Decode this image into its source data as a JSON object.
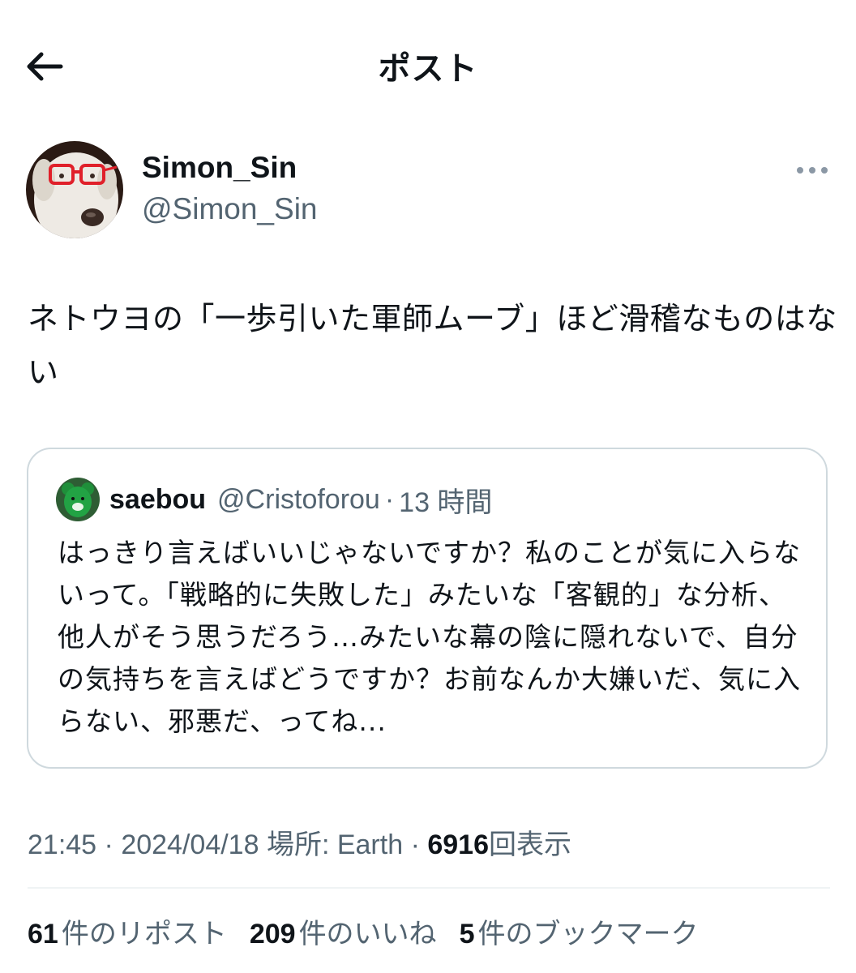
{
  "header": {
    "title": "ポスト"
  },
  "author": {
    "name": "Simon_Sin",
    "handle": "@Simon_Sin"
  },
  "post": {
    "text": "ネトウヨの「一歩引いた軍師ムーブ」ほど滑稽なものはない"
  },
  "quote": {
    "name": "saebou",
    "handle": "@Cristoforou",
    "dot": "·",
    "time": "13 時間",
    "text": "はっきり言えばいいじゃないですか？私のことが気に入らないって。「戦略的に失敗した」みたいな「客観的」な分析、他人がそう思うだろう…みたいな幕の陰に隠れないで、自分の気持ちを言えばどうですか？お前なんか大嫌いだ、気に入らない、邪悪だ、ってね..."
  },
  "meta": {
    "time": "21:45",
    "sep1": "·",
    "date": "2024/04/18",
    "location": "場所: Earth",
    "sep2": "·",
    "views_count": "6916",
    "views_label": "回表示"
  },
  "stats": {
    "reposts_count": "61",
    "reposts_label": "件のリポスト",
    "likes_count": "209",
    "likes_label": "件のいいね",
    "bookmarks_count": "5",
    "bookmarks_label": "件のブックマーク"
  },
  "icons": {
    "back": "arrow-left-icon",
    "more": "ellipsis-icon"
  },
  "colors": {
    "primary_text": "#0f1419",
    "secondary_text": "#536471",
    "border": "#cfd9de",
    "divider": "#eff3f4",
    "quote_avatar_green": "#1f8f3a"
  }
}
